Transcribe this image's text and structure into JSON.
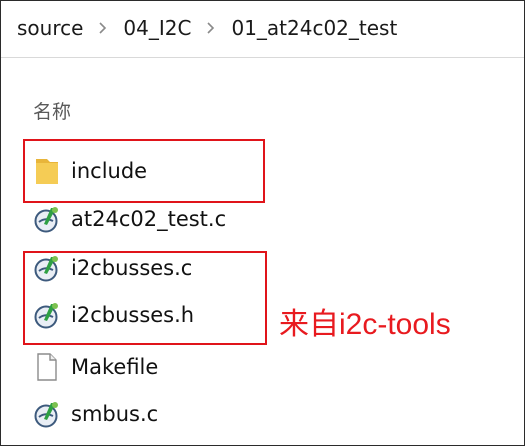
{
  "breadcrumb": {
    "items": [
      "source",
      "04_I2C",
      "01_at24c02_test"
    ]
  },
  "columns": {
    "name_header": "名称"
  },
  "files": [
    {
      "name": "include",
      "type": "folder",
      "icon": "folder-icon"
    },
    {
      "name": "at24c02_test.c",
      "type": "c-source",
      "icon": "c-file-icon"
    },
    {
      "name": "i2cbusses.c",
      "type": "c-source",
      "icon": "c-file-icon"
    },
    {
      "name": "i2cbusses.h",
      "type": "c-header",
      "icon": "c-file-icon"
    },
    {
      "name": "Makefile",
      "type": "file",
      "icon": "blank-file-icon"
    },
    {
      "name": "smbus.c",
      "type": "c-source",
      "icon": "c-file-icon"
    }
  ],
  "annotation": {
    "text": "来自i2c-tools",
    "color": "#e81a1f"
  },
  "colors": {
    "highlight_box": "#e0141a",
    "folder": "#f3c54a"
  }
}
